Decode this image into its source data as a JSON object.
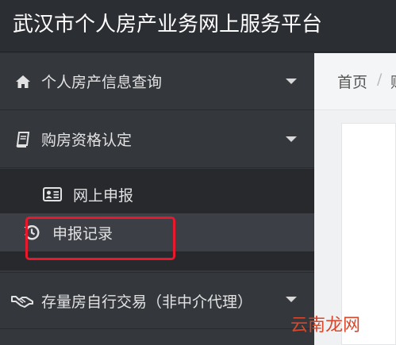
{
  "app": {
    "title": "武汉市个人房产业务网上服务平台"
  },
  "sidebar": {
    "items": [
      {
        "label": "个人房产信息查询",
        "icon": "home-icon"
      },
      {
        "label": "购房资格认定",
        "icon": "book-icon",
        "children": [
          {
            "label": "网上申报",
            "icon": "id-card-icon"
          },
          {
            "label": "申报记录",
            "icon": "history-icon",
            "active": true
          }
        ]
      },
      {
        "label": "存量房自行交易（非中介代理）",
        "icon": "handshake-icon"
      }
    ]
  },
  "breadcrumb": {
    "home": "首页",
    "separator": "/",
    "next": "购"
  },
  "watermark": {
    "text": "云南龙网"
  },
  "colors": {
    "highlight": "#e8192c",
    "sidebar": "#34373c",
    "submenu": "#27292d"
  }
}
